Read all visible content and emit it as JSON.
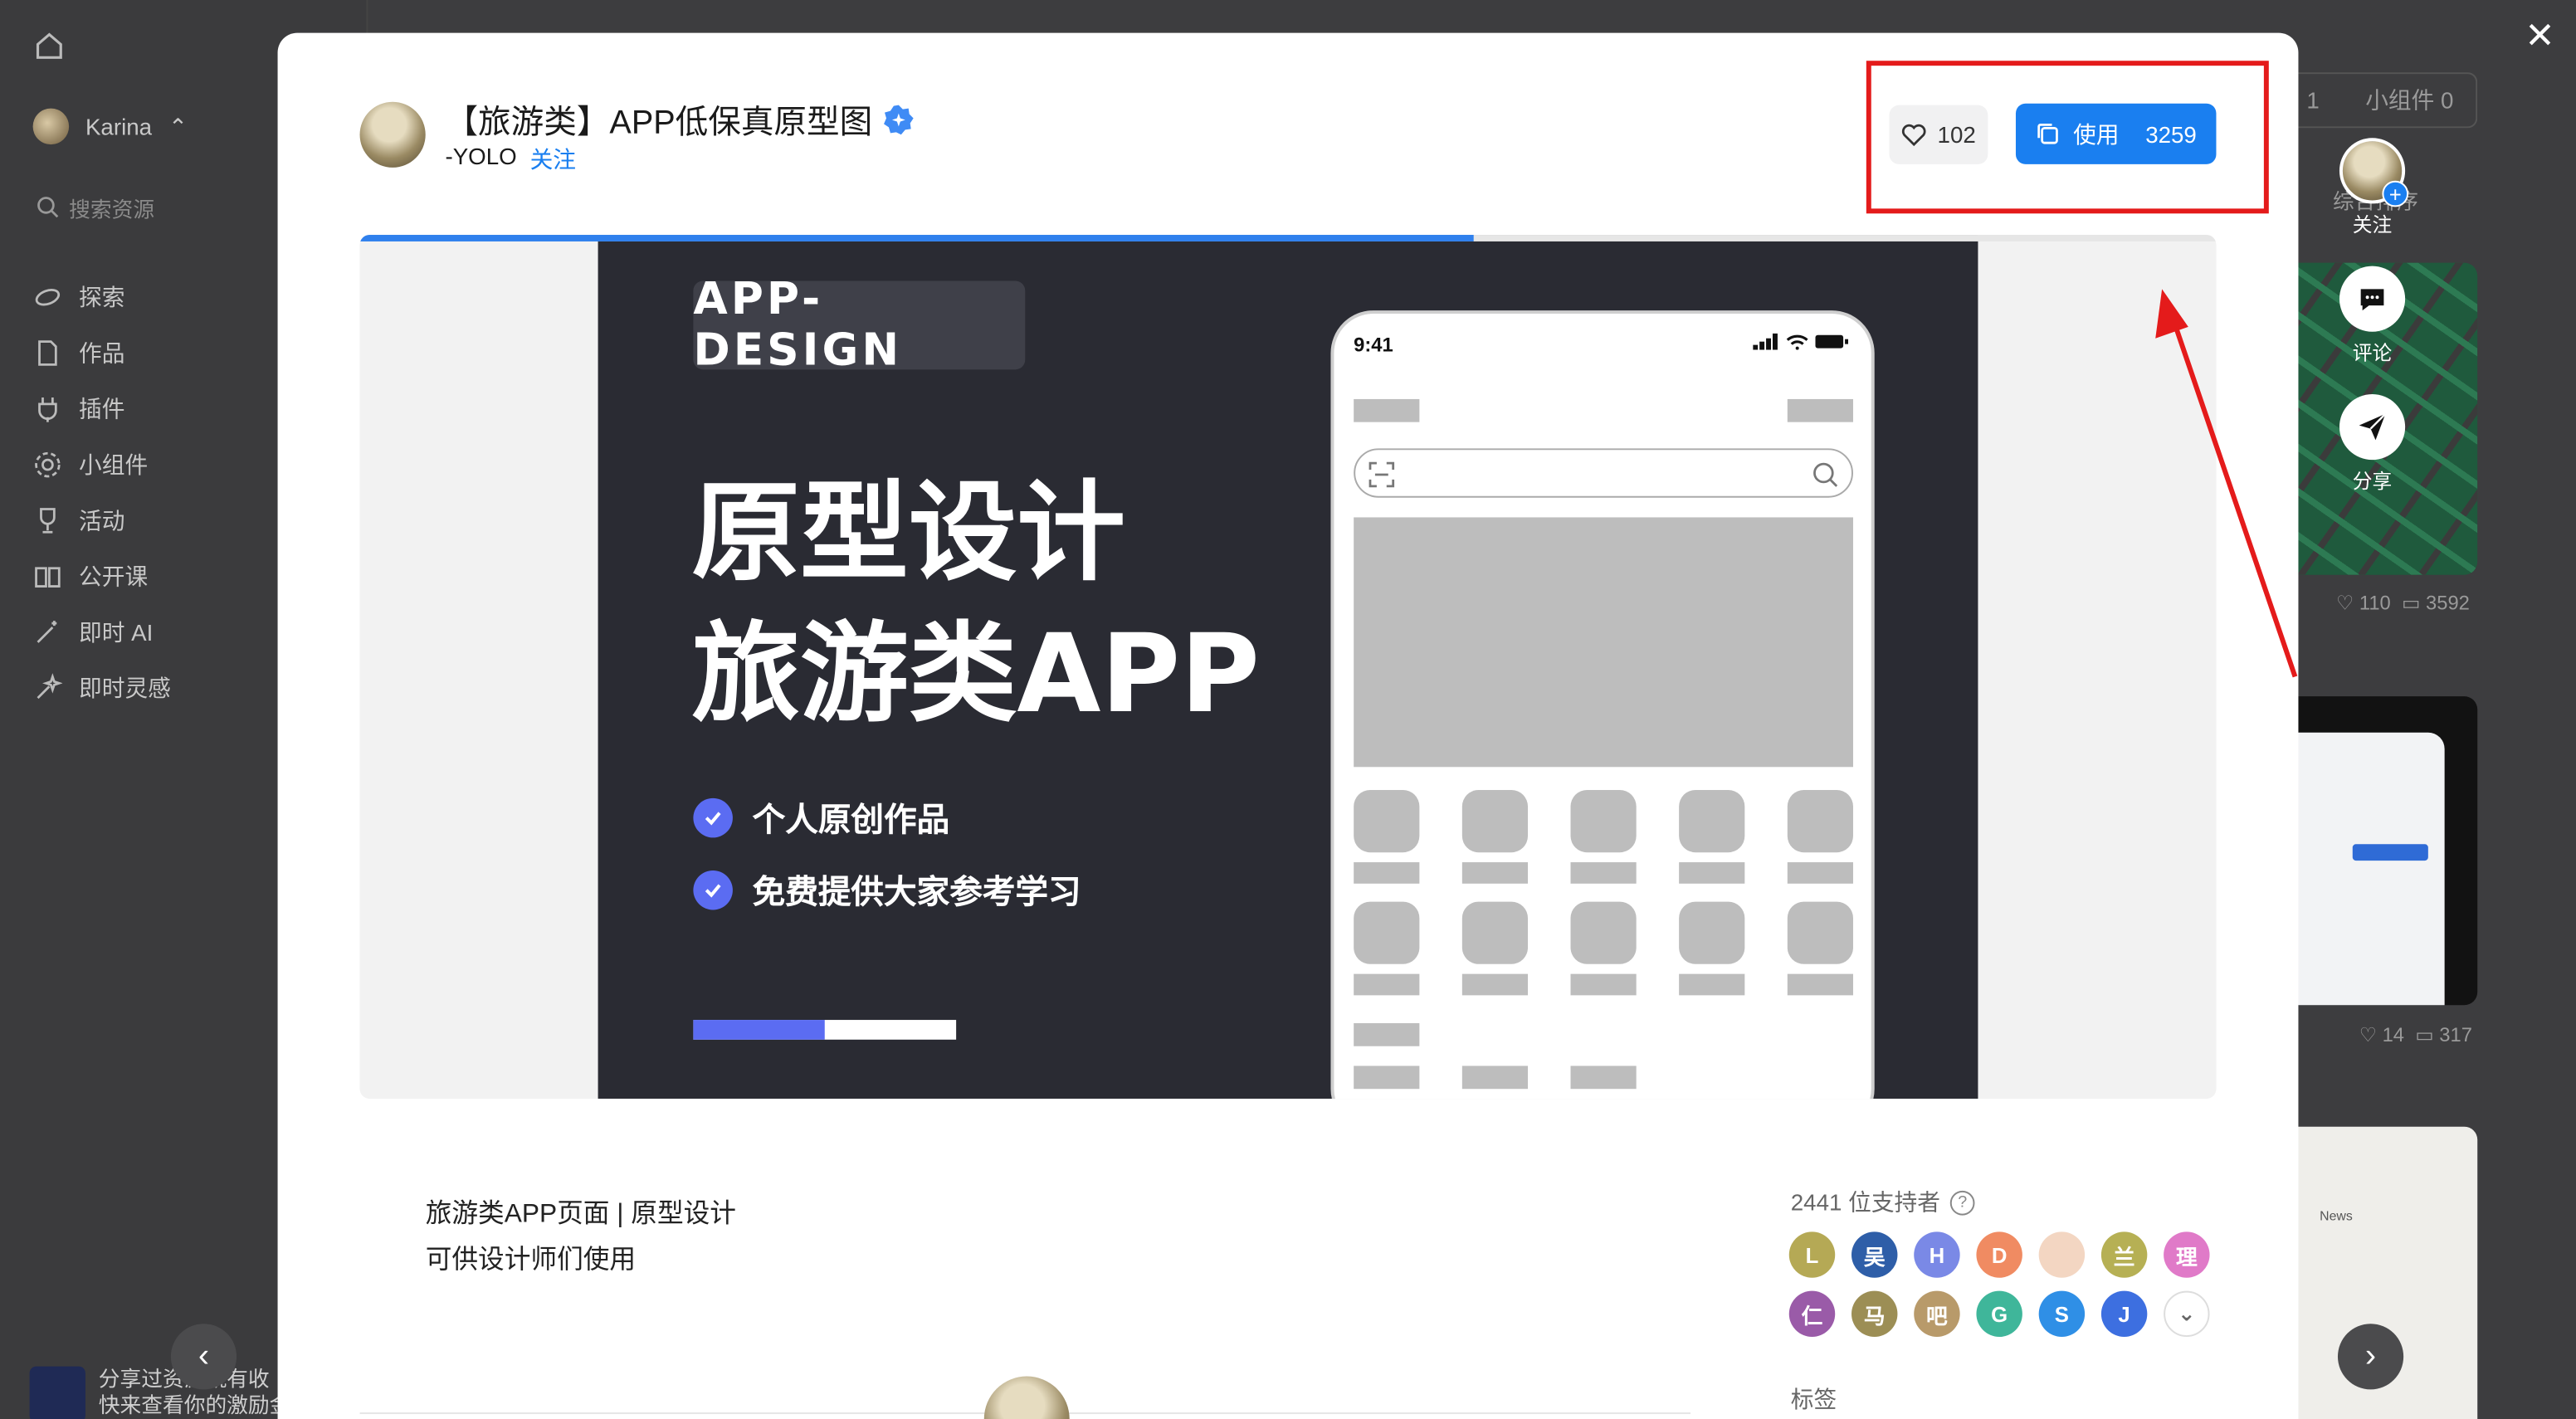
{
  "sidebar": {
    "username": "Karina",
    "search_placeholder": "搜索资源",
    "nav": [
      "探索",
      "作品",
      "插件",
      "小组件",
      "活动",
      "公开课",
      "即时 AI",
      "即时灵感"
    ],
    "promo_line1": "分享过资源就有收",
    "promo_line2": "快来查看你的激励金"
  },
  "background": {
    "tab_partial": "1",
    "tab_widgets": "小组件 0",
    "sort_label": "综合排序",
    "card1_likes": "110",
    "card1_comments": "3592",
    "card2_likes": "14",
    "card2_comments": "317",
    "card3_news": "News"
  },
  "modal": {
    "title": "【旅游类】APP低保真原型图",
    "author": "-YOLO",
    "follow_label": "关注",
    "like_count": "102",
    "use_label": "使用",
    "use_count": "3259",
    "progress_fraction": 0.6
  },
  "poster": {
    "tag": "APP-DESIGN",
    "headline1": "原型设计",
    "headline2": "旅游类APP",
    "feature1": "个人原创作品",
    "feature2": "免费提供大家参考学习",
    "phone_time": "9:41",
    "bar_fill_fraction": 0.5
  },
  "description": {
    "line1": "旅游类APP页面 | 原型设计",
    "line2": "可供设计师们使用"
  },
  "supporters": {
    "label": "2441 位支持者",
    "help": "?",
    "avatars": [
      {
        "text": "L",
        "color": "#b5a955"
      },
      {
        "text": "吴",
        "color": "#2e5ea8"
      },
      {
        "text": "H",
        "color": "#7a89e6"
      },
      {
        "text": "D",
        "color": "#f08b62"
      },
      {
        "text": "",
        "color": "#f3d6c2"
      },
      {
        "text": "兰",
        "color": "#b6b054"
      },
      {
        "text": "理",
        "color": "#e07ac8"
      },
      {
        "text": "仁",
        "color": "#9a5ba8"
      },
      {
        "text": "马",
        "color": "#9c8e55"
      },
      {
        "text": "吧",
        "color": "#b89a6a"
      },
      {
        "text": "G",
        "color": "#3fb69a"
      },
      {
        "text": "S",
        "color": "#2f8fe6"
      },
      {
        "text": "J",
        "color": "#3d6fe0"
      }
    ],
    "more_icon": "chevron-down-icon"
  },
  "tags_label": "标签",
  "side_actions": {
    "follow_label": "关注",
    "comment_label": "评论",
    "share_label": "分享"
  },
  "colors": {
    "accent": "#1a7ff0",
    "poster_bg": "#2a2b33",
    "poster_accent": "#5b6cf2",
    "highlight": "#e41b1b"
  }
}
